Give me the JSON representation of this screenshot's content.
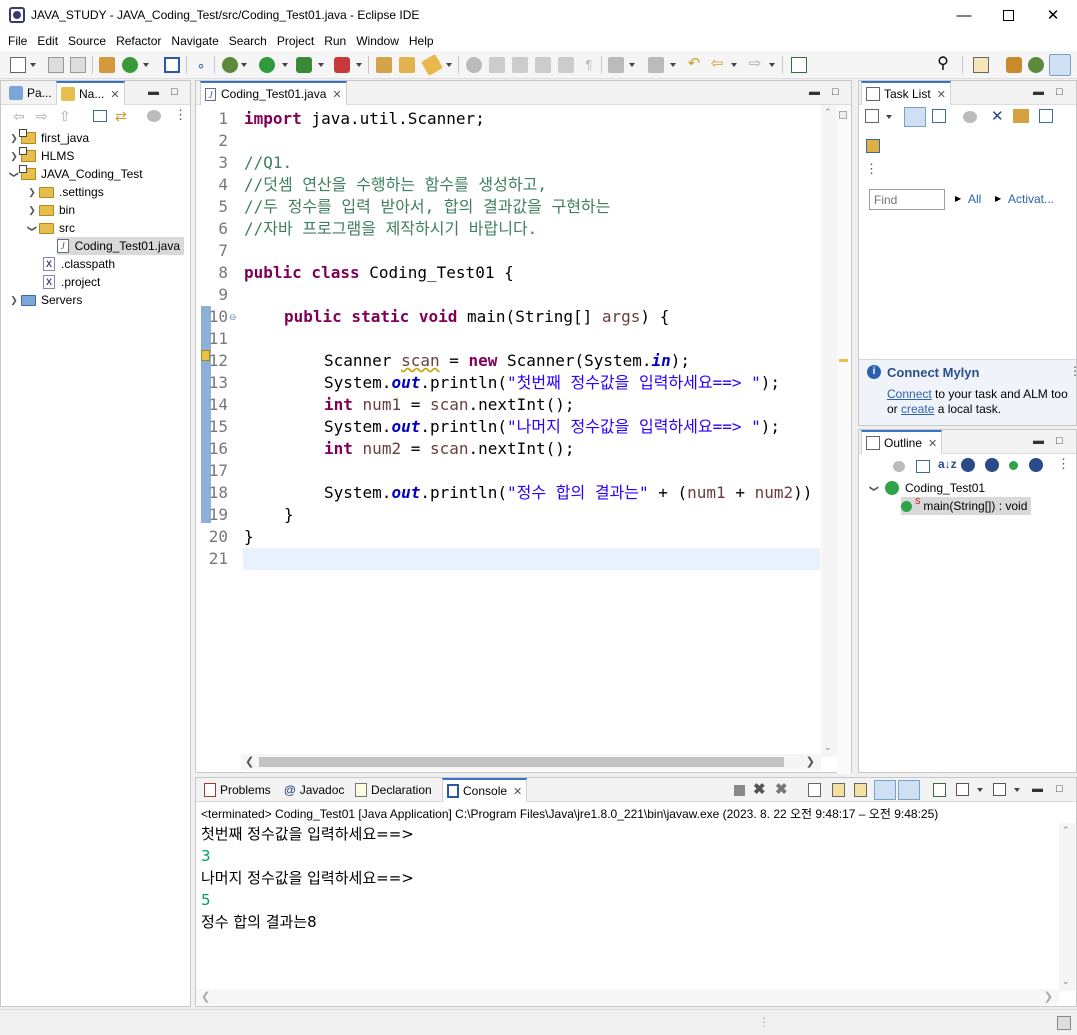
{
  "window": {
    "title": "JAVA_STUDY - JAVA_Coding_Test/src/Coding_Test01.java - Eclipse IDE"
  },
  "menu": [
    "File",
    "Edit",
    "Source",
    "Refactor",
    "Navigate",
    "Search",
    "Project",
    "Run",
    "Window",
    "Help"
  ],
  "left_panel": {
    "tabs": [
      {
        "label": "Pa..."
      },
      {
        "label": "Na..."
      }
    ],
    "tree": [
      {
        "label": "first_java"
      },
      {
        "label": "HLMS"
      },
      {
        "label": "JAVA_Coding_Test"
      },
      {
        "label": ".settings"
      },
      {
        "label": "bin"
      },
      {
        "label": "src"
      },
      {
        "label": "Coding_Test01.java"
      },
      {
        "label": ".classpath"
      },
      {
        "label": ".project"
      },
      {
        "label": "Servers"
      }
    ]
  },
  "editor": {
    "tab_label": "Coding_Test01.java",
    "line_numbers": [
      "1",
      "2",
      "3",
      "4",
      "5",
      "6",
      "7",
      "8",
      "9",
      "10",
      "11",
      "12",
      "13",
      "14",
      "15",
      "16",
      "17",
      "18",
      "19",
      "20",
      "21"
    ],
    "code": {
      "l1_kw": "import",
      "l1_rest": " java.util.Scanner;",
      "l3": "//Q1.",
      "l4": "//덧셈 연산을 수행하는 함수를 생성하고,",
      "l5": "//두 정수를 입력 받아서, 합의 결과값을 구현하는",
      "l6": "//자바 프로그램을 제작하시기 바랍니다.",
      "l8_kw": "public class",
      "l8_rest": " Coding_Test01 {",
      "l10_kw": "public static void",
      "l10_a": " main(String[] ",
      "l10_var": "args",
      "l10_b": ") {",
      "l12_a": "Scanner ",
      "l12_var": "scan",
      "l12_b": " = ",
      "l12_kw": "new",
      "l12_c": " Scanner(System.",
      "l12_fld": "in",
      "l12_d": ");",
      "l13_a": "System.",
      "l13_fld": "out",
      "l13_b": ".println(",
      "l13_str": "\"첫번째 정수값을 입력하세요==> \"",
      "l13_c": ");",
      "l14_kw": "int",
      "l14_a": " ",
      "l14_var": "num1",
      "l14_b": " = ",
      "l14_var2": "scan",
      "l14_c": ".nextInt();",
      "l15_a": "System.",
      "l15_fld": "out",
      "l15_b": ".println(",
      "l15_str": "\"나머지 정수값을 입력하세요==> \"",
      "l15_c": ");",
      "l16_kw": "int",
      "l16_a": " ",
      "l16_var": "num2",
      "l16_b": " = ",
      "l16_var2": "scan",
      "l16_c": ".nextInt();",
      "l18_a": "System.",
      "l18_fld": "out",
      "l18_b": ".println(",
      "l18_str": "\"정수 합의 결과는\"",
      "l18_c": " + (",
      "l18_var": "num1",
      "l18_d": " + ",
      "l18_var2": "num2",
      "l18_e": "))",
      "l19": "}",
      "l20": "}"
    }
  },
  "task_list": {
    "tab_label": "Task List",
    "find_placeholder": "Find",
    "filter_all": "All",
    "filter_activate": "Activat...",
    "mylyn_title": "Connect Mylyn",
    "mylyn_connect": "Connect",
    "mylyn_text1": " to your task and ALM too",
    "mylyn_or": "or ",
    "mylyn_create": "create",
    "mylyn_text2": " a local task."
  },
  "outline": {
    "tab_label": "Outline",
    "class_name": "Coding_Test01",
    "method": "main(String[]) : void"
  },
  "bottom_panel": {
    "tabs": [
      {
        "label": "Problems"
      },
      {
        "label": "Javadoc"
      },
      {
        "label": "Declaration"
      },
      {
        "label": "Console"
      }
    ],
    "status_line": "<terminated> Coding_Test01 [Java Application] C:\\Program Files\\Java\\jre1.8.0_221\\bin\\javaw.exe  (2023. 8. 22 오전 9:48:17 – 오전 9:48:25)",
    "output": [
      {
        "text": "첫번째 정수값을 입력하세요==>"
      },
      {
        "text": "3"
      },
      {
        "text": "나머지 정수값을 입력하세요==>"
      },
      {
        "text": "5"
      },
      {
        "text": "정수 합의 결과는8"
      }
    ]
  },
  "colors": {
    "keyword": "#7f0055",
    "comment": "#3f7f5f",
    "string": "#2a00ff",
    "field": "#0000c0",
    "input": "#00a060",
    "accent": "#3873c9"
  }
}
